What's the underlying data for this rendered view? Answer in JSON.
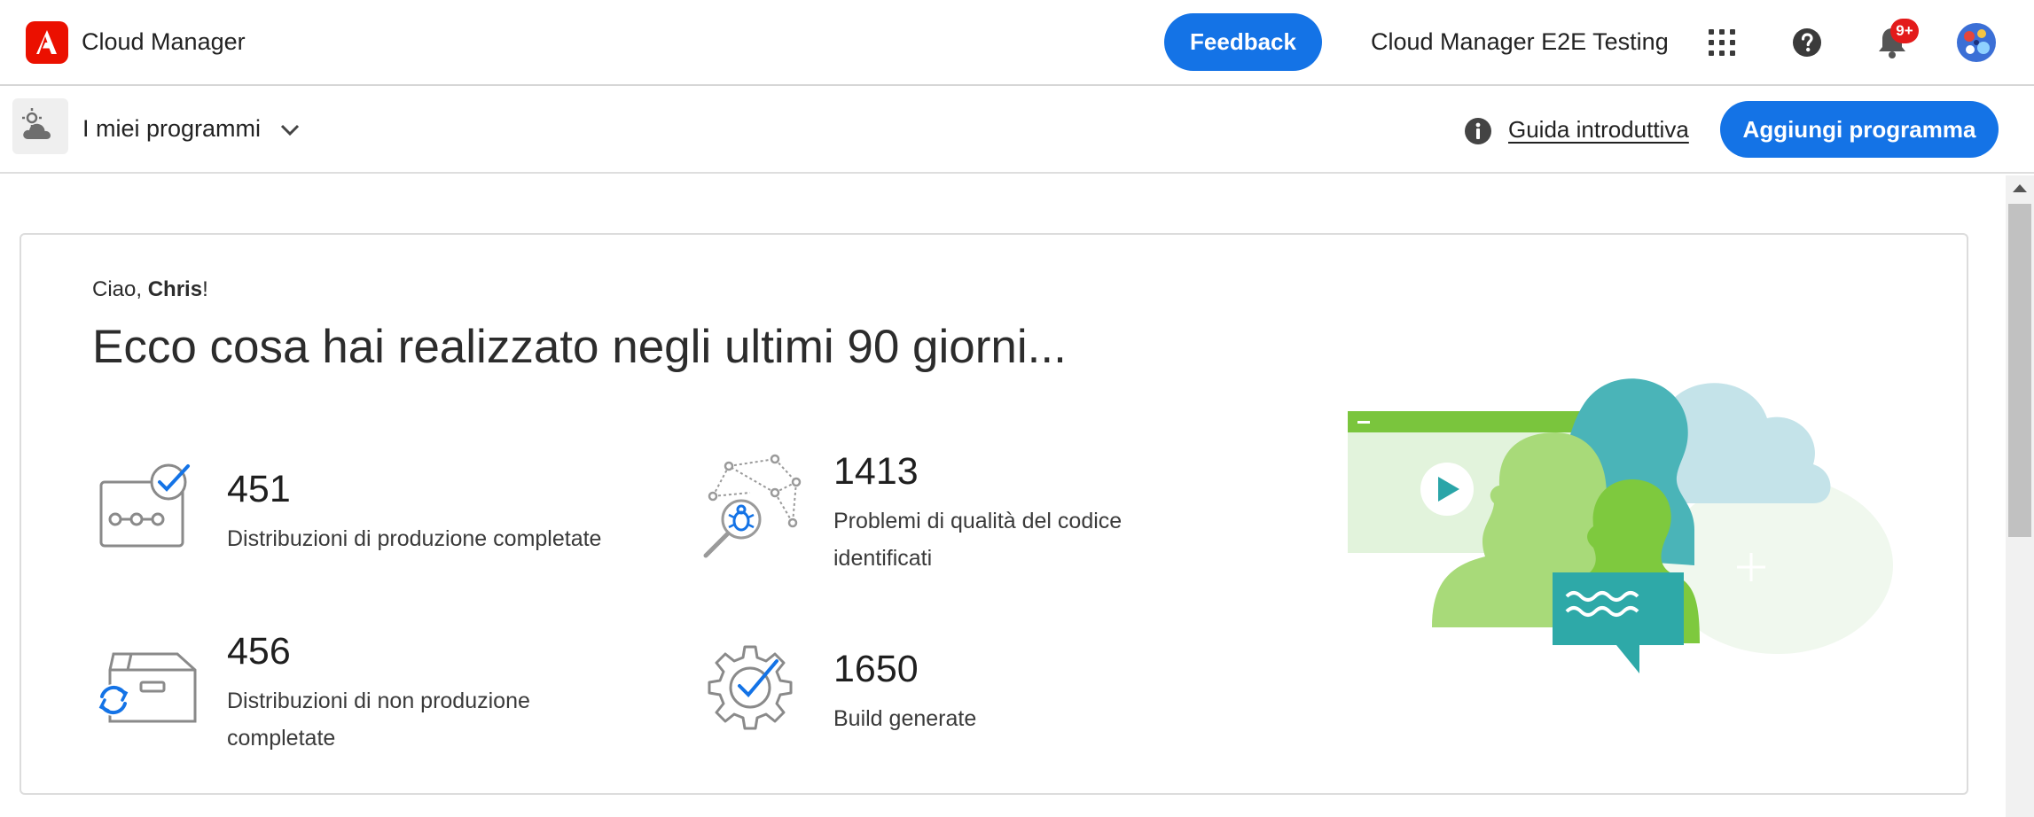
{
  "header": {
    "app_title": "Cloud Manager",
    "feedback_label": "Feedback",
    "org_name": "Cloud Manager E2E Testing",
    "notification_count": "9+",
    "icons": [
      "adobe-logo",
      "apps-grid-icon",
      "help-icon",
      "bell-icon",
      "avatar"
    ]
  },
  "subheader": {
    "program_selector": "I miei programmi",
    "guide_link": "Guida introduttiva",
    "add_program_label": "Aggiungi programma"
  },
  "summary": {
    "greeting_prefix": "Ciao, ",
    "user_name": "Chris",
    "greeting_suffix": "!",
    "headline": "Ecco cosa hai realizzato negli ultimi 90 giorni...",
    "stats": [
      {
        "value": "451",
        "label_line1": "Distribuzioni di produzione completate",
        "label_line2": "",
        "icon": "pipeline-check-icon"
      },
      {
        "value": "1413",
        "label_line1": "Problemi di qualità del codice",
        "label_line2": "identificati",
        "icon": "bug-search-icon"
      },
      {
        "value": "456",
        "label_line1": "Distribuzioni di non produzione",
        "label_line2": "completate",
        "icon": "box-refresh-icon"
      },
      {
        "value": "1650",
        "label_line1": "Build generate",
        "label_line2": "",
        "icon": "gear-check-icon"
      }
    ]
  },
  "colors": {
    "accent": "#1473e6",
    "adobe_red": "#eb1000",
    "badge_red": "#e31b1b"
  }
}
